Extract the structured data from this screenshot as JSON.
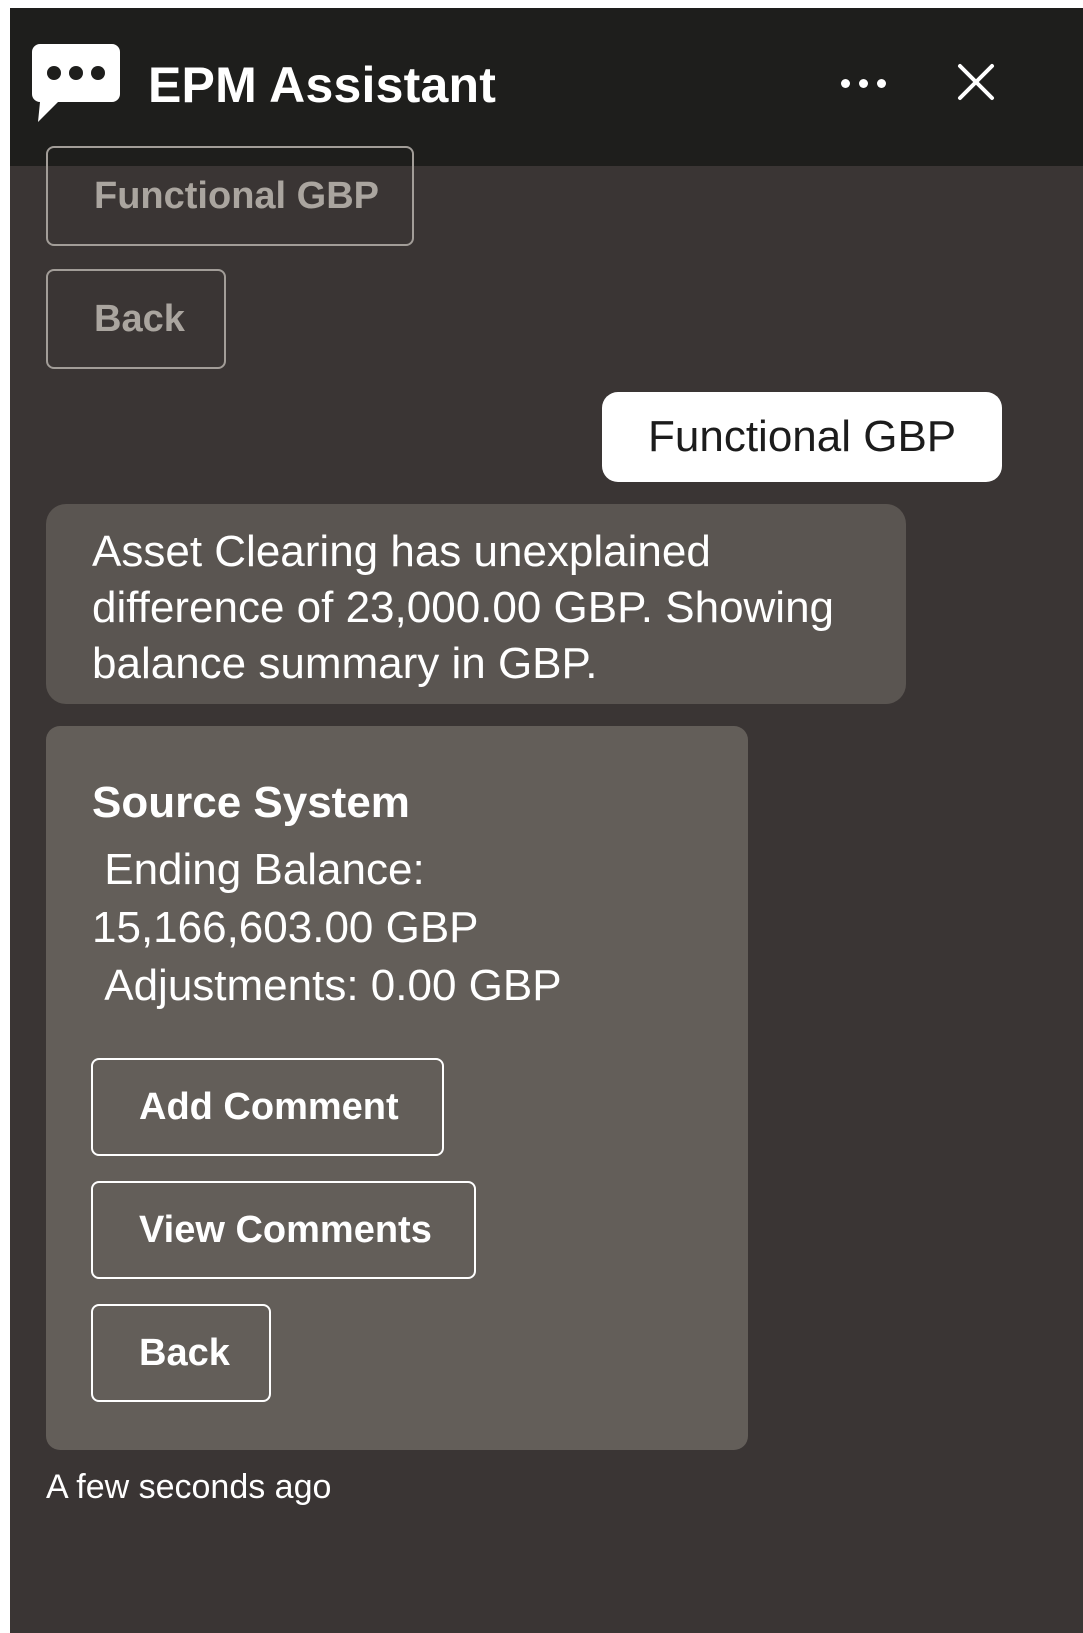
{
  "header": {
    "title": "EPM Assistant",
    "icons": {
      "logo": "chat-bubble-icon",
      "more": "more-horizontal-icon",
      "close": "close-icon"
    }
  },
  "previous_options": {
    "functional_gbp_label": "Functional GBP",
    "back_label": "Back"
  },
  "user_message": {
    "text": "Functional GBP"
  },
  "bot_message": {
    "text": "Asset Clearing has unexplained difference of 23,000.00 GBP. Showing balance summary in GBP."
  },
  "card": {
    "title": "Source System",
    "body": " Ending Balance:\n15,166,603.00 GBP\n Adjustments: 0.00 GBP",
    "buttons": {
      "add_comment": "Add Comment",
      "view_comments": "View Comments",
      "back": "Back"
    }
  },
  "timestamp": "A few seconds ago",
  "colors": {
    "header_bg": "#1e1e1c",
    "chat_bg": "#3a3534",
    "bot_bubble_bg": "#5a5551",
    "card_bg": "#635e59",
    "user_bubble_bg": "#ffffff"
  }
}
